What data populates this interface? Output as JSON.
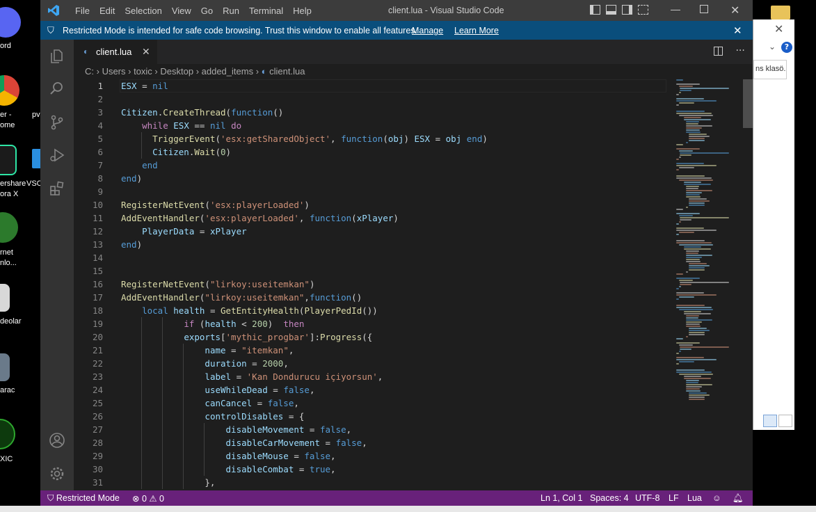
{
  "desktop": {
    "labels": [
      "ord",
      "er -",
      "ome",
      "pv",
      "VSC",
      "ershare",
      "ora X",
      "rnet",
      "nlo...",
      "deolar",
      "arac",
      "XIC"
    ]
  },
  "background_window": {
    "input_text": "ns klasö..."
  },
  "window": {
    "title": "client.lua - Visual Studio Code",
    "menu": [
      "File",
      "Edit",
      "Selection",
      "View",
      "Go",
      "Run",
      "Terminal",
      "Help"
    ]
  },
  "banner": {
    "message": "Restricted Mode is intended for safe code browsing. Trust this window to enable all features.",
    "manage": "Manage",
    "learn_more": "Learn More"
  },
  "tab": {
    "name": "client.lua"
  },
  "breadcrumbs": [
    "C:",
    "Users",
    "toxic",
    "Desktop",
    "added_items",
    "client.lua"
  ],
  "code": {
    "lines": [
      "ESX = nil",
      "",
      "Citizen.CreateThread(function()",
      "    while ESX == nil do",
      "      TriggerEvent('esx:getSharedObject', function(obj) ESX = obj end)",
      "      Citizen.Wait(0)",
      "    end",
      "end)",
      "",
      "RegisterNetEvent('esx:playerLoaded')",
      "AddEventHandler('esx:playerLoaded', function(xPlayer)",
      "    PlayerData = xPlayer",
      "end)",
      "",
      "",
      "RegisterNetEvent(\"lirkoy:useitemkan\")",
      "AddEventHandler(\"lirkoy:useitemkan\",function()",
      "    local health = GetEntityHealth(PlayerPedId())",
      "            if (health < 200)  then",
      "            exports['mythic_progbar']:Progress({",
      "                name = \"itemkan\",",
      "                duration = 2000,",
      "                label = 'Kan Dondurucu içiyorsun',",
      "                useWhileDead = false,",
      "                canCancel = false,",
      "                controlDisables = {",
      "                    disableMovement = false,",
      "                    disableCarMovement = false,",
      "                    disableMouse = false,",
      "                    disableCombat = true,",
      "                },"
    ],
    "line_numbers": [
      "1",
      "2",
      "3",
      "4",
      "5",
      "6",
      "7",
      "8",
      "9",
      "10",
      "11",
      "12",
      "13",
      "14",
      "15",
      "16",
      "17",
      "18",
      "19",
      "20",
      "21",
      "22",
      "23",
      "24",
      "25",
      "26",
      "27",
      "28",
      "29",
      "30",
      "31"
    ]
  },
  "status": {
    "restricted": "Restricted Mode",
    "problems": "⊗ 0 ⚠ 0",
    "position": "Ln 1, Col 1",
    "spaces": "Spaces: 4",
    "encoding": "UTF-8",
    "eol": "LF",
    "language": "Lua"
  },
  "colors": {
    "keyword": "#569cd6",
    "string": "#ce9178",
    "function": "#dcdcaa",
    "variable": "#9cdcfe",
    "number": "#b5cea8",
    "control": "#c586c0",
    "statusbar": "#68217a",
    "banner": "#0a4e7c"
  }
}
